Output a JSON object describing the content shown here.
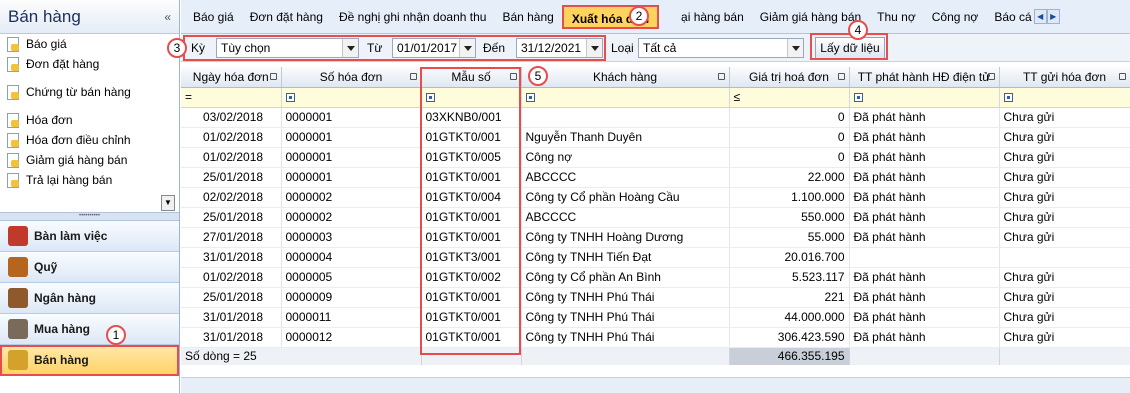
{
  "sidebar": {
    "title": "Bán hàng",
    "collapse": "«",
    "items": [
      "Báo giá",
      "Đơn đặt hàng",
      "Chứng từ bán hàng",
      "Hóa đơn",
      "Hóa đơn điều chỉnh",
      "Giảm giá hàng bán",
      "Trả lại hàng bán"
    ],
    "modules": [
      {
        "label": "Bàn làm việc",
        "color": "#c0392b"
      },
      {
        "label": "Quỹ",
        "color": "#b5651d"
      },
      {
        "label": "Ngân hàng",
        "color": "#8e5a2b"
      },
      {
        "label": "Mua hàng",
        "color": "#7a6a5a"
      },
      {
        "label": "Bán hàng",
        "color": "#d4a22a"
      }
    ]
  },
  "tabs": [
    "Báo giá",
    "Đơn đặt hàng",
    "Đề nghị ghi nhận doanh thu",
    "Bán hàng",
    "Xuất hóa đơn",
    "ại hàng bán",
    "Giảm giá hàng bán",
    "Thu nợ",
    "Công nợ",
    "Báo cá"
  ],
  "active_tab": "Xuất hóa đơn",
  "filter": {
    "ky_label": "Kỳ",
    "ky_value": "Tùy chọn",
    "tu_label": "Từ",
    "tu_value": "01/01/2017",
    "den_label": "Đến",
    "den_value": "31/12/2021",
    "loai_label": "Loại",
    "loai_value": "Tất cả",
    "fetch_button": "Lấy dữ liệu"
  },
  "columns": [
    "Ngày hóa đơn",
    "Số hóa đơn",
    "Mẫu số",
    "Khách hàng",
    "Giá trị hoá đơn",
    "TT phát hành HĐ điện tử",
    "TT gửi hóa đơn"
  ],
  "filter_row": {
    "date_op": "=",
    "value_op": "≤"
  },
  "rows": [
    [
      "03/02/2018",
      "0000001",
      "03XKNB0/001",
      "",
      "0",
      "Đã phát hành",
      "Chưa gửi"
    ],
    [
      "01/02/2018",
      "0000001",
      "01GTKT0/001",
      "Nguyễn Thanh Duyên",
      "0",
      "Đã phát hành",
      "Chưa gửi"
    ],
    [
      "01/02/2018",
      "0000001",
      "01GTKT0/005",
      "Công nợ",
      "0",
      "Đã phát hành",
      "Chưa gửi"
    ],
    [
      "25/01/2018",
      "0000001",
      "01GTKT0/001",
      "ABCCCC",
      "22.000",
      "Đã phát hành",
      "Chưa gửi"
    ],
    [
      "02/02/2018",
      "0000002",
      "01GTKT0/004",
      "Công ty Cổ phần Hoàng Cầu",
      "1.100.000",
      "Đã phát hành",
      "Chưa gửi"
    ],
    [
      "25/01/2018",
      "0000002",
      "01GTKT0/001",
      "ABCCCC",
      "550.000",
      "Đã phát hành",
      "Chưa gửi"
    ],
    [
      "27/01/2018",
      "0000003",
      "01GTKT0/001",
      "Công ty TNHH Hoàng Dương",
      "55.000",
      "Đã phát hành",
      "Chưa gửi"
    ],
    [
      "31/01/2018",
      "0000004",
      "01GTKT3/001",
      "Công ty TNHH Tiến Đạt",
      "20.016.700",
      "",
      ""
    ],
    [
      "01/02/2018",
      "0000005",
      "01GTKT0/002",
      "Công ty Cổ phần An Bình",
      "5.523.117",
      "Đã phát hành",
      "Chưa gửi"
    ],
    [
      "25/01/2018",
      "0000009",
      "01GTKT0/001",
      "Công ty TNHH Phú Thái",
      "221",
      "Đã phát hành",
      "Chưa gửi"
    ],
    [
      "31/01/2018",
      "0000011",
      "01GTKT0/001",
      "Công ty TNHH Phú Thái",
      "44.000.000",
      "Đã phát hành",
      "Chưa gửi"
    ],
    [
      "31/01/2018",
      "0000012",
      "01GTKT0/001",
      "Công ty TNHH Phú Thái",
      "306.423.590",
      "Đã phát hành",
      "Chưa gửi"
    ]
  ],
  "footer": {
    "row_count": "Số dòng = 25",
    "total": "466.355.195"
  },
  "badges": [
    "1",
    "2",
    "3",
    "4",
    "5"
  ]
}
